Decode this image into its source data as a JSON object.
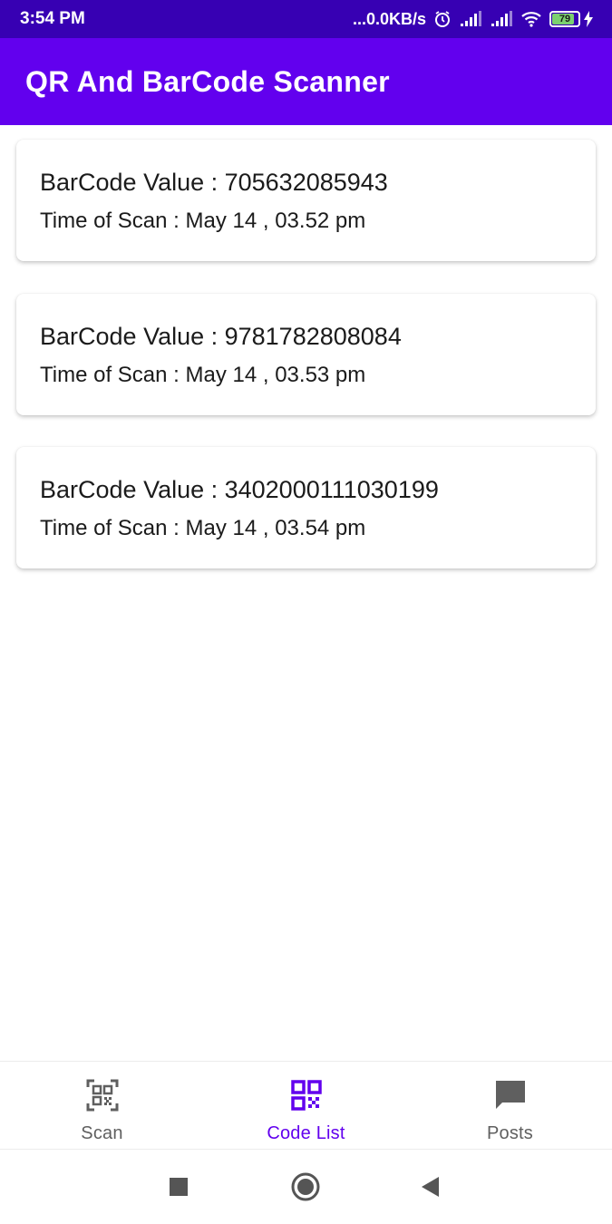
{
  "status_bar": {
    "time": "3:54 PM",
    "network_speed": "...0.0KB/s",
    "battery_level": "79"
  },
  "app_bar": {
    "title": "QR And BarCode Scanner",
    "color": "#6200ee"
  },
  "scans": [
    {
      "value_text": "BarCode Value : 705632085943",
      "time_text": "Time of Scan : May 14 , 03.52 pm"
    },
    {
      "value_text": "BarCode Value : 9781782808084",
      "time_text": "Time of Scan : May 14 , 03.53 pm"
    },
    {
      "value_text": "BarCode Value : 3402000111030199",
      "time_text": "Time of Scan : May 14 , 03.54 pm"
    }
  ],
  "bottom_nav": {
    "items": [
      {
        "label": "Scan",
        "icon": "qr-scan-icon",
        "active": false
      },
      {
        "label": "Code List",
        "icon": "qr-code-icon",
        "active": true
      },
      {
        "label": "Posts",
        "icon": "chat-bubble-icon",
        "active": false
      }
    ],
    "active_color": "#6200ee",
    "inactive_color": "#5f5f5f"
  },
  "system_nav": {
    "buttons": [
      "recents-square-icon",
      "home-circle-icon",
      "back-triangle-icon"
    ]
  }
}
